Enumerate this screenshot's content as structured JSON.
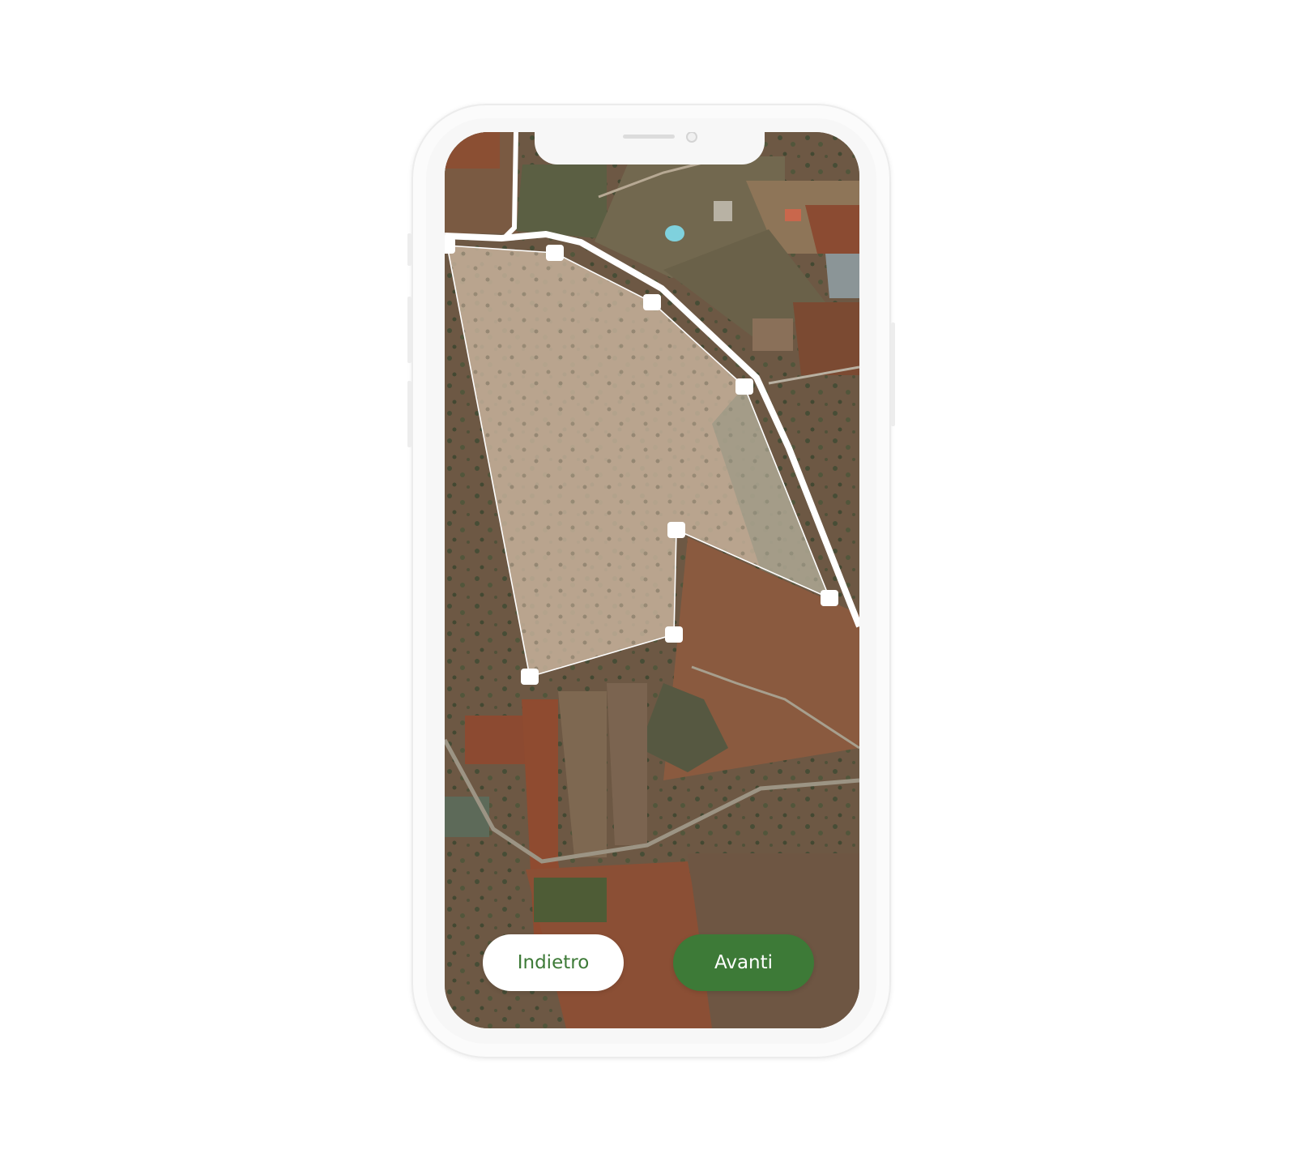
{
  "buttons": {
    "back_label": "Indietro",
    "next_label": "Avanti"
  },
  "colors": {
    "accent_green": "#3d7a37",
    "button_white": "#ffffff",
    "boundary_line": "#ffffff",
    "selection_fill": "#cbb6a0"
  },
  "map": {
    "type": "satellite",
    "selected_parcel_vertices": 9
  }
}
